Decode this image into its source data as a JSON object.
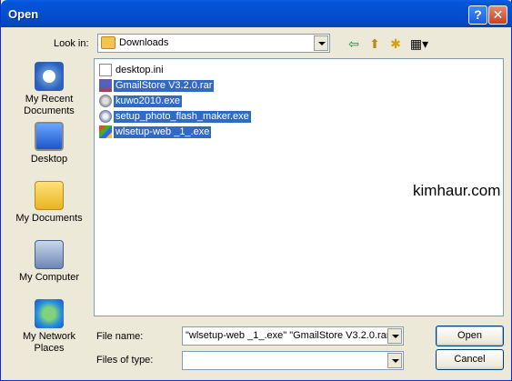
{
  "window": {
    "title": "Open",
    "help_label": "?",
    "close_label": "✕"
  },
  "toolbar": {
    "look_in_label": "Look in:",
    "look_in_value": "Downloads",
    "tools": [
      {
        "name": "back-icon",
        "glyph": "⇦"
      },
      {
        "name": "up-folder-icon",
        "glyph": "⬆"
      },
      {
        "name": "new-folder-icon",
        "glyph": "✱"
      },
      {
        "name": "view-menu-icon",
        "glyph": "▦▾"
      }
    ]
  },
  "places": [
    {
      "label": "My Recent Documents",
      "icon": "recent-documents-icon"
    },
    {
      "label": "Desktop",
      "icon": "desktop-icon"
    },
    {
      "label": "My Documents",
      "icon": "my-documents-icon"
    },
    {
      "label": "My Computer",
      "icon": "my-computer-icon"
    },
    {
      "label": "My Network Places",
      "icon": "network-places-icon"
    }
  ],
  "files": [
    {
      "name": "desktop.ini",
      "type": "ini",
      "selected": false
    },
    {
      "name": "GmailStore V3.2.0.rar",
      "type": "rar",
      "selected": true
    },
    {
      "name": "kuwo2010.exe",
      "type": "kuwo",
      "selected": true
    },
    {
      "name": "setup_photo_flash_maker.exe",
      "type": "photo",
      "selected": true
    },
    {
      "name": "wlsetup-web _1_.exe",
      "type": "wl",
      "selected": true
    }
  ],
  "watermark": "kimhaur.com",
  "form": {
    "file_name_label": "File name:",
    "file_name_value": "\"wlsetup-web _1_.exe\" \"GmailStore V3.2.0.rar\"",
    "files_of_type_label": "Files of type:",
    "files_of_type_value": ""
  },
  "buttons": {
    "open_label": "Open",
    "cancel_label": "Cancel"
  },
  "colors": {
    "selection": "#316ac5",
    "titlebar": "#0454d8",
    "dialog_bg": "#ece9d8"
  }
}
